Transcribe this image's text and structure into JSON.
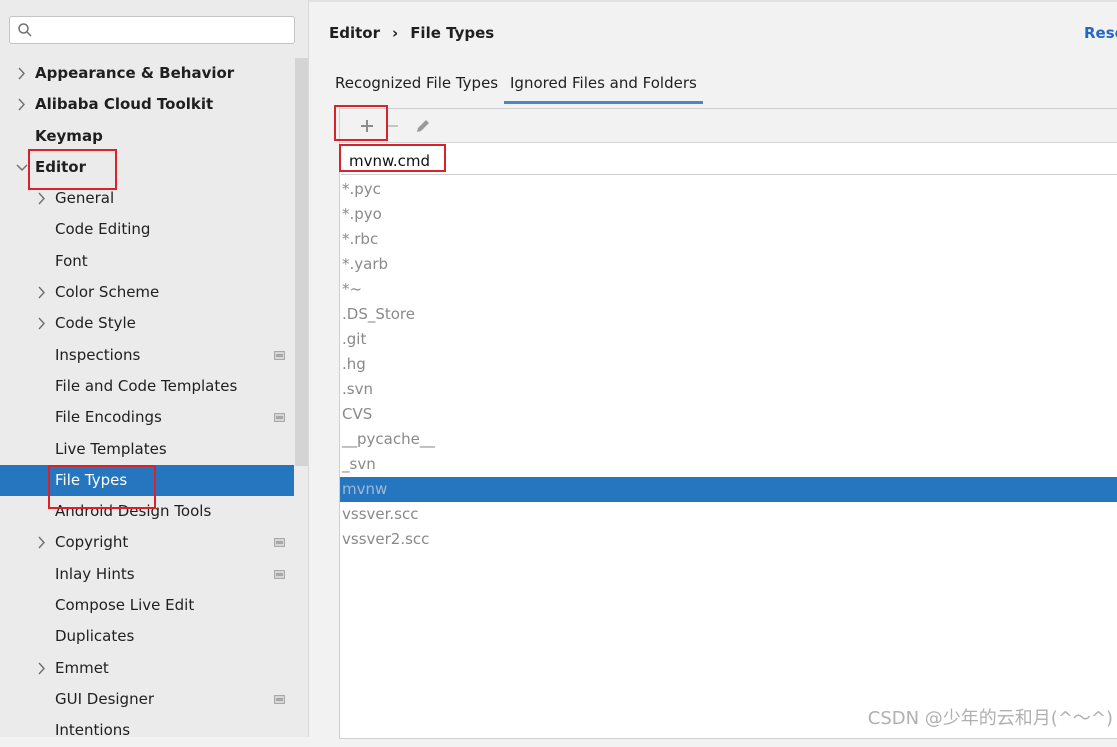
{
  "search": {
    "placeholder": "",
    "value": ""
  },
  "sidebar": {
    "items": [
      {
        "label": "Appearance & Behavior",
        "level": 0,
        "arrow": "right"
      },
      {
        "label": "Alibaba Cloud Toolkit",
        "level": 0,
        "arrow": "right"
      },
      {
        "label": "Keymap",
        "level": 0,
        "arrow": ""
      },
      {
        "label": "Editor",
        "level": 0,
        "arrow": "down"
      },
      {
        "label": "General",
        "level": 1,
        "arrow": "right"
      },
      {
        "label": "Code Editing",
        "level": 1,
        "arrow": ""
      },
      {
        "label": "Font",
        "level": 1,
        "arrow": ""
      },
      {
        "label": "Color Scheme",
        "level": 1,
        "arrow": "right"
      },
      {
        "label": "Code Style",
        "level": 1,
        "arrow": "right"
      },
      {
        "label": "Inspections",
        "level": 1,
        "arrow": "",
        "page": true
      },
      {
        "label": "File and Code Templates",
        "level": 1,
        "arrow": ""
      },
      {
        "label": "File Encodings",
        "level": 1,
        "arrow": "",
        "page": true
      },
      {
        "label": "Live Templates",
        "level": 1,
        "arrow": ""
      },
      {
        "label": "File Types",
        "level": 1,
        "arrow": "",
        "selected": true
      },
      {
        "label": "Android Design Tools",
        "level": 1,
        "arrow": ""
      },
      {
        "label": "Copyright",
        "level": 1,
        "arrow": "right",
        "page": true
      },
      {
        "label": "Inlay Hints",
        "level": 1,
        "arrow": "",
        "page": true
      },
      {
        "label": "Compose Live Edit",
        "level": 1,
        "arrow": ""
      },
      {
        "label": "Duplicates",
        "level": 1,
        "arrow": ""
      },
      {
        "label": "Emmet",
        "level": 1,
        "arrow": "right"
      },
      {
        "label": "GUI Designer",
        "level": 1,
        "arrow": "",
        "page": true
      },
      {
        "label": "Intentions",
        "level": 1,
        "arrow": ""
      }
    ]
  },
  "breadcrumb": {
    "parent": "Editor",
    "separator": "›",
    "current": "File Types"
  },
  "reset_label": "Rese",
  "tabs": [
    {
      "label": "Recognized File Types",
      "active": false
    },
    {
      "label": "Ignored Files and Folders",
      "active": true
    }
  ],
  "toolbar": {
    "icons": [
      "add-icon",
      "remove-icon",
      "edit-icon"
    ]
  },
  "editor": {
    "value": "mvnw.cmd"
  },
  "patterns": [
    "*.pyc",
    "*.pyo",
    "*.rbc",
    "*.yarb",
    "*~",
    ".DS_Store",
    ".git",
    ".hg",
    ".svn",
    "CVS",
    "__pycache__",
    "_svn",
    "mvnw",
    "vssver.scc",
    "vssver2.scc"
  ],
  "selected_pattern": "mvnw",
  "watermark": "CSDN @少年的云和月(^～^)",
  "colors": {
    "accent": "#2675bf",
    "highlight": "#d9232a",
    "link": "#2467c4"
  }
}
